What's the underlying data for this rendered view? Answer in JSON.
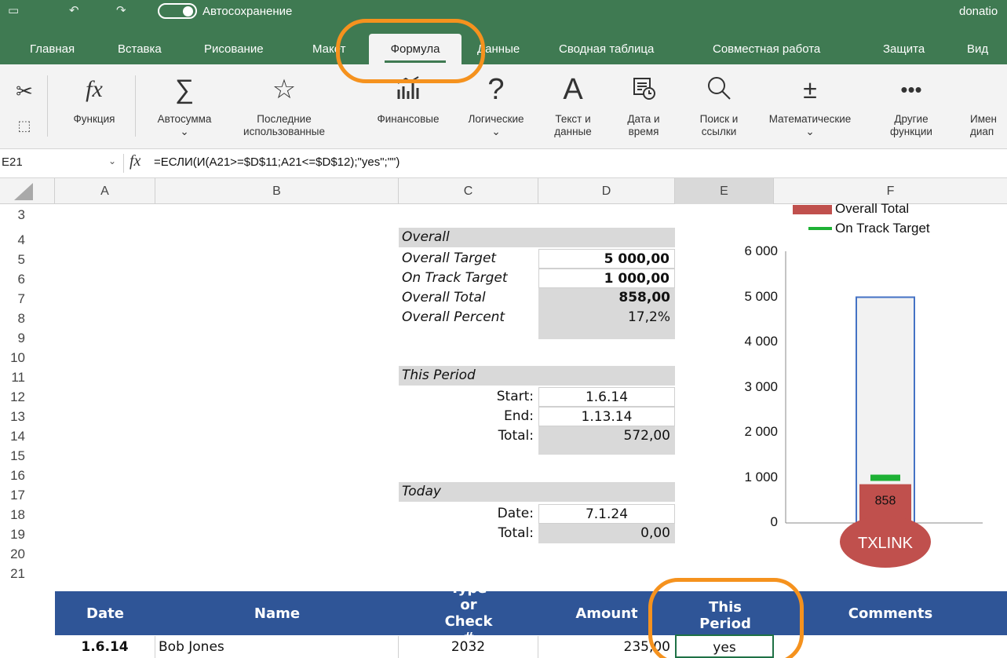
{
  "titlebar": {
    "autosave_label": "Автосохранение",
    "filename": "donatio"
  },
  "tabs": [
    {
      "label": "Главная"
    },
    {
      "label": "Вставка"
    },
    {
      "label": "Рисование"
    },
    {
      "label": "Макет"
    },
    {
      "label": "Формула"
    },
    {
      "label": "Данные"
    },
    {
      "label": "Сводная таблица"
    },
    {
      "label": "Совместная работа"
    },
    {
      "label": "Защита"
    },
    {
      "label": "Вид"
    }
  ],
  "active_tab": "Формула",
  "ribbon": {
    "function_label": "Функция",
    "autosum_label": "Автосумма",
    "recent_label": "Последние использованные",
    "financial_label": "Финансовые",
    "logical_label": "Логические",
    "text_label": "Текст и данные",
    "datetime_label": "Дата и время",
    "lookup_label": "Поиск и ссылки",
    "math_label": "Математические",
    "other_label": "Другие функции",
    "names_label": "Имен диап"
  },
  "formula_bar": {
    "name_box": "E21",
    "formula": "=ЕСЛИ(И(A21>=$D$11;A21<=$D$12);\"yes\";\"\")"
  },
  "columns": [
    "A",
    "B",
    "C",
    "D",
    "E",
    "F"
  ],
  "rows": [
    "3",
    "4",
    "5",
    "6",
    "7",
    "8",
    "9",
    "10",
    "11",
    "12",
    "13",
    "14",
    "15",
    "16",
    "17",
    "18",
    "19",
    "20",
    "21"
  ],
  "summary": {
    "overall_header": "Overall",
    "overall_target_label": "Overall Target",
    "overall_target_value": "5 000,00",
    "on_track_label": "On Track Target",
    "on_track_value": "1 000,00",
    "overall_total_label": "Overall Total",
    "overall_total_value": "858,00",
    "overall_percent_label": "Overall Percent",
    "overall_percent_value": "17,2%",
    "period_header": "This Period",
    "start_label": "Start:",
    "start_value": "1.6.14",
    "end_label": "End:",
    "end_value": "1.13.14",
    "period_total_label": "Total:",
    "period_total_value": "572,00",
    "today_header": "Today",
    "date_label": "Date:",
    "date_value": "7.1.24",
    "today_total_label": "Total:",
    "today_total_value": "0,00"
  },
  "table": {
    "headers": [
      "Date",
      "Name",
      "Type or Check #",
      "Amount",
      "This Period",
      "Comments"
    ],
    "rows": [
      {
        "date": "1.6.14",
        "name": "Bob Jones",
        "type": "2032",
        "amount": "235,00",
        "period": "yes"
      }
    ]
  },
  "chart_data": {
    "type": "bar",
    "categories": [
      ""
    ],
    "series": [
      {
        "name": "Overall Total",
        "values": [
          858
        ],
        "color": "#c0504d"
      },
      {
        "name": "On Track Target",
        "values": [
          1000
        ],
        "color": "#1eb135"
      }
    ],
    "overall_target": 5000,
    "ylim": [
      0,
      6000
    ],
    "yticks": [
      "0",
      "1 000",
      "2 000",
      "3 000",
      "4 000",
      "5 000",
      "6 000"
    ],
    "data_label": "858",
    "logo_text": "TXLINK",
    "legend_position": "top-right",
    "colors": {
      "target_outline": "#4472c4",
      "bar_fill": "#c0504d",
      "target_marker": "#1eb135",
      "logo": "#c0504d"
    }
  },
  "colors": {
    "ribbon_green": "#3f7a52",
    "header_blue": "#2f5597",
    "highlight_orange": "#f5921e"
  }
}
